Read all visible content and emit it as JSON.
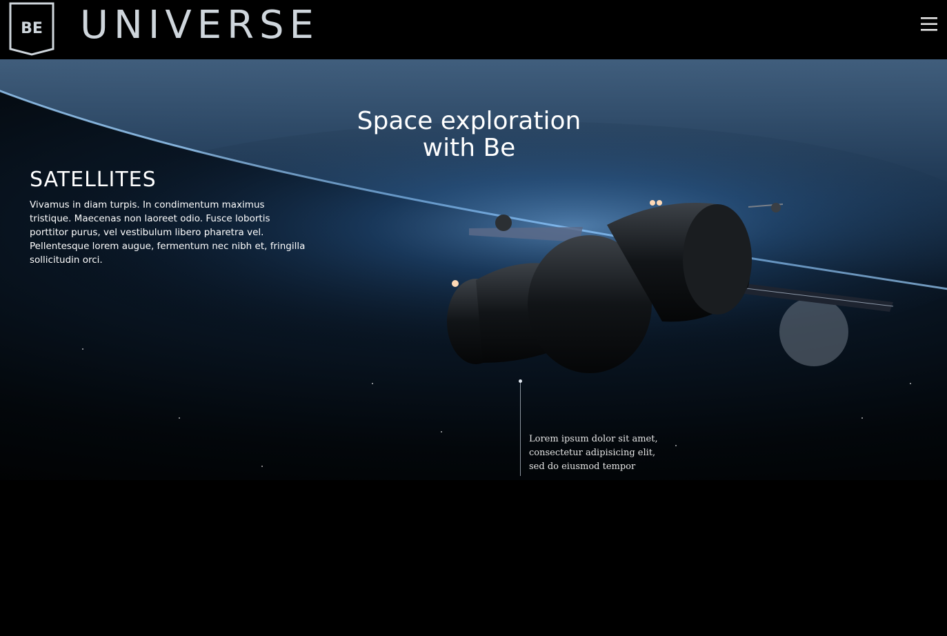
{
  "header": {
    "logo_text": "BE",
    "brand": "UNIVERSE",
    "menu_icon": "hamburger-menu-icon"
  },
  "hero": {
    "title_line1": "Space exploration",
    "title_line2": "with Be",
    "section": {
      "heading": "SATELLITES",
      "body": "Vivamus in diam turpis. In condimentum maximus tristique. Maecenas non laoreet odio. Fusce lobortis porttitor purus, vel vestibulum libero pharetra vel. Pellentesque lorem augue, fermentum nec nibh et, fringilla sollicitudin orci."
    },
    "callout": "Lorem ipsum dolor sit amet, consectetur adipisicing elit, sed do eiusmod tempor"
  },
  "colors": {
    "background": "#000000",
    "brand_text": "#cfd6dc",
    "text": "#ffffff",
    "glow": "#5fa6e6"
  }
}
